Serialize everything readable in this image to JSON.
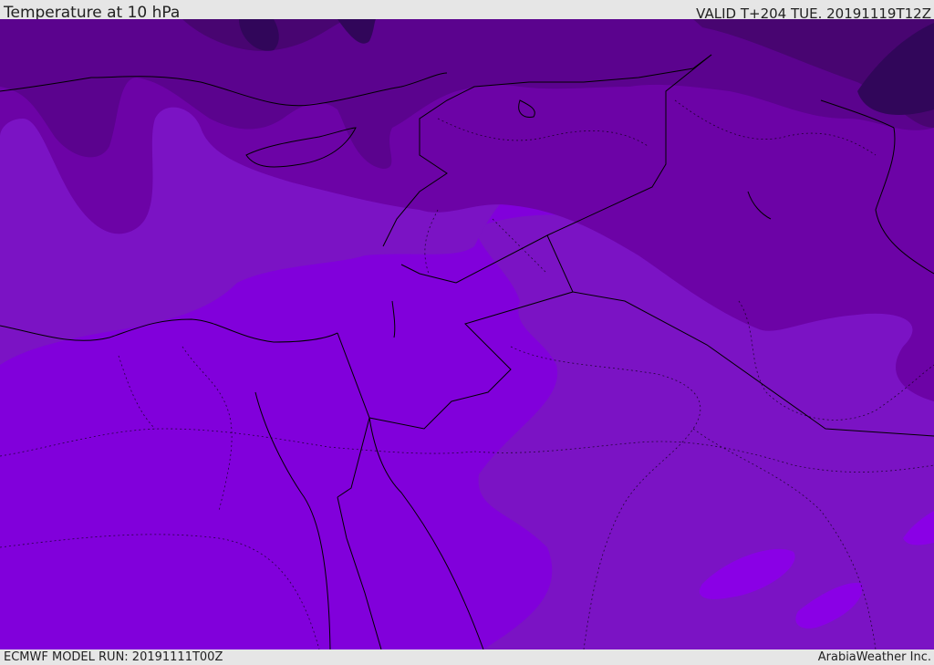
{
  "header": {
    "title": "Temperature at 10 hPa",
    "valid": "VALID T+204 TUE. 20191119T12Z"
  },
  "footer": {
    "model_run": "ECMWF MODEL RUN: 20191111T00Z",
    "credit": "ArabiaWeather Inc."
  },
  "map": {
    "region": "Eastern Mediterranean / Middle East",
    "palette": {
      "warmest": "#8100db",
      "warm": "#7b13c4",
      "mid": "#6c03a6",
      "cool": "#5b038e",
      "cold": "#480571",
      "coldest": "#31065a"
    }
  }
}
